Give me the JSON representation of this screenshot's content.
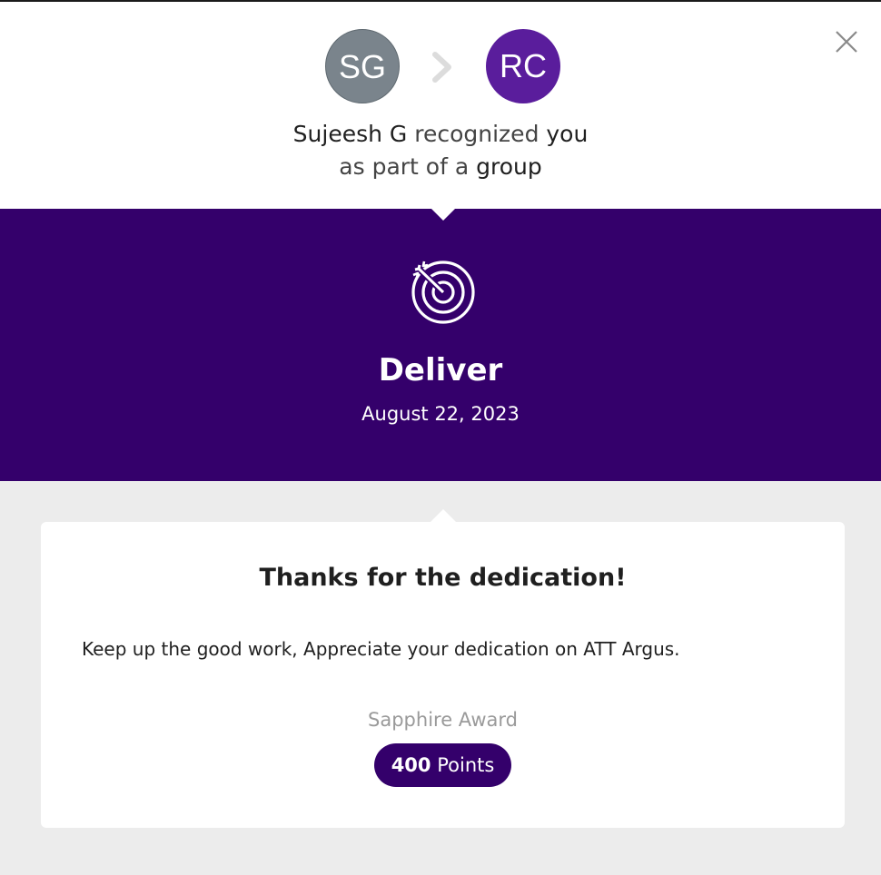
{
  "recognition": {
    "sender": {
      "initials": "SG",
      "name": "Sujeesh G",
      "color": "#7a848c"
    },
    "receiver": {
      "initials": "RC",
      "color": "#5a1d9c"
    },
    "headline": {
      "verb": "recognized",
      "object": "you",
      "line2_prefix": "as part of a",
      "line2_emphasis": "group"
    }
  },
  "value": {
    "icon": "target-icon",
    "title": "Deliver",
    "date": "August 22, 2023",
    "banner_color": "#34006b"
  },
  "message": {
    "title": "Thanks for the dedication!",
    "body": "Keep up the good work, Appreciate your dedication on ATT Argus."
  },
  "award": {
    "name": "Sapphire Award",
    "points": "400",
    "points_label": "Points"
  },
  "controls": {
    "close_icon": "close-icon",
    "separator_icon": "chevron-right-icon"
  }
}
